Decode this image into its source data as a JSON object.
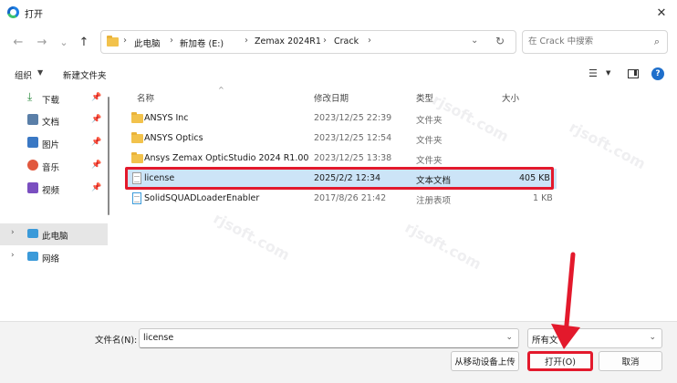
{
  "window": {
    "title": "打开"
  },
  "nav": {
    "back": "←",
    "forward": "→",
    "dropdown": "⌄",
    "up": "↑",
    "breadcrumb": [
      "此电脑",
      "新加卷 (E:)",
      "Zemax 2024R1",
      "Crack"
    ],
    "search_placeholder": "在 Crack 中搜索"
  },
  "toolbar": {
    "organize": "组织",
    "new_folder": "新建文件夹"
  },
  "sidebar": {
    "quick": [
      {
        "label": "下载",
        "icon": "download-icon",
        "color": "#2b8a3e"
      },
      {
        "label": "文档",
        "icon": "documents-icon",
        "color": "#5a7fa8"
      },
      {
        "label": "图片",
        "icon": "pictures-icon",
        "color": "#3a78c4"
      },
      {
        "label": "音乐",
        "icon": "music-icon",
        "color": "#e1583e"
      },
      {
        "label": "视频",
        "icon": "videos-icon",
        "color": "#7a4fc0"
      }
    ],
    "this_pc": "此电脑",
    "network": "网络"
  },
  "columns": {
    "name": "名称",
    "modified": "修改日期",
    "type": "类型",
    "size": "大小"
  },
  "files": [
    {
      "name": "ANSYS Inc",
      "modified": "2023/12/25 22:39",
      "type": "文件夹",
      "size": "",
      "kind": "folder"
    },
    {
      "name": "ANSYS Optics",
      "modified": "2023/12/25 12:54",
      "type": "文件夹",
      "size": "",
      "kind": "folder"
    },
    {
      "name": "Ansys Zemax OpticStudio 2024 R1.00",
      "modified": "2023/12/25 13:38",
      "type": "文件夹",
      "size": "",
      "kind": "folder"
    },
    {
      "name": "license",
      "modified": "2025/2/2 12:34",
      "type": "文本文档",
      "size": "405 KB",
      "kind": "file",
      "selected": true
    },
    {
      "name": "SolidSQUADLoaderEnabler",
      "modified": "2017/8/26 21:42",
      "type": "注册表项",
      "size": "1 KB",
      "kind": "reg"
    }
  ],
  "bottom": {
    "filename_label": "文件名(N):",
    "filename_value": "license",
    "filetype": "所有文",
    "btn_mobile": "从移动设备上传",
    "btn_open": "打开(O)",
    "btn_cancel": "取消"
  },
  "colors": {
    "highlight_red": "#e3192c",
    "selection_blue": "#cce4f7"
  }
}
